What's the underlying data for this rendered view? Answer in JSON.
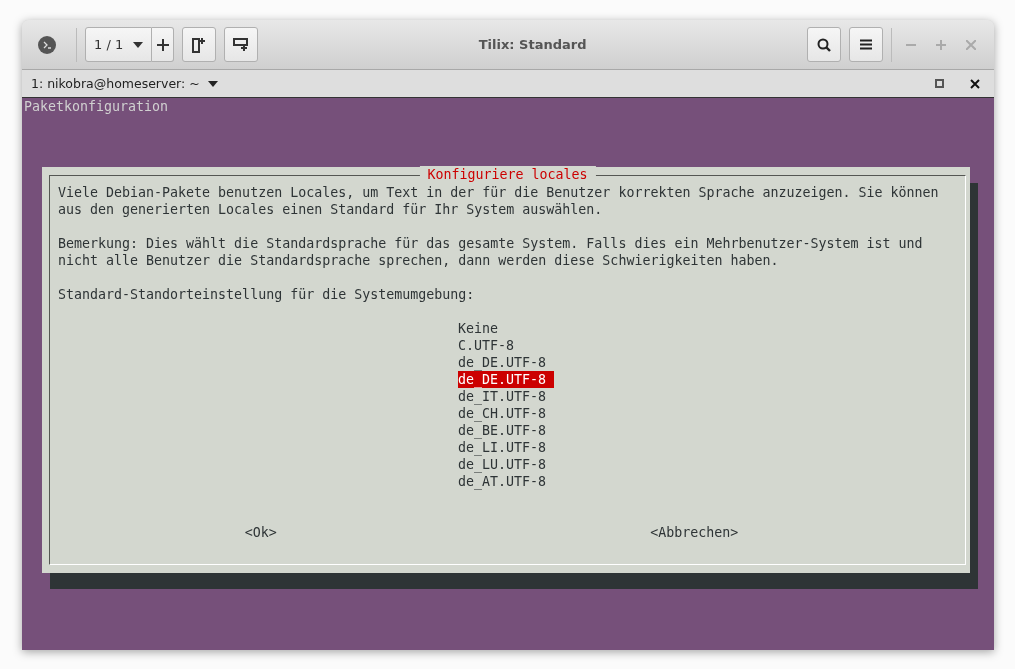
{
  "window": {
    "title": "Tilix: Standard",
    "session_label": "1 / 1"
  },
  "terminal_tab": {
    "title": "1: nikobra@homeserver: ~"
  },
  "terminal": {
    "header": "Paketkonfiguration",
    "dialog": {
      "title": "Konfiguriere locales",
      "paragraphs": [
        "Viele Debian-Pakete benutzen Locales, um Text in der für die Benutzer korrekten Sprache anzuzeigen. Sie können\naus den generierten Locales einen Standard für Ihr System auswählen.",
        "Bemerkung: Dies wählt die Standardsprache für das gesamte System. Falls dies ein Mehrbenutzer-System ist und\nnicht alle Benutzer die Standardsprache sprechen, dann werden diese Schwierigkeiten haben.",
        "Standard-Standorteinstellung für die Systemumgebung:"
      ],
      "options": [
        {
          "label": "Keine",
          "selected": false
        },
        {
          "label": "C.UTF-8",
          "selected": false
        },
        {
          "label": "de_DE.UTF-8",
          "selected": false
        },
        {
          "label": "de_DE.UTF-8",
          "selected": true
        },
        {
          "label": "de_IT.UTF-8",
          "selected": false
        },
        {
          "label": "de_CH.UTF-8",
          "selected": false
        },
        {
          "label": "de_BE.UTF-8",
          "selected": false
        },
        {
          "label": "de_LI.UTF-8",
          "selected": false
        },
        {
          "label": "de_LU.UTF-8",
          "selected": false
        },
        {
          "label": "de_AT.UTF-8",
          "selected": false
        }
      ],
      "buttons": [
        "<Ok>",
        "<Abbrechen>"
      ]
    }
  }
}
